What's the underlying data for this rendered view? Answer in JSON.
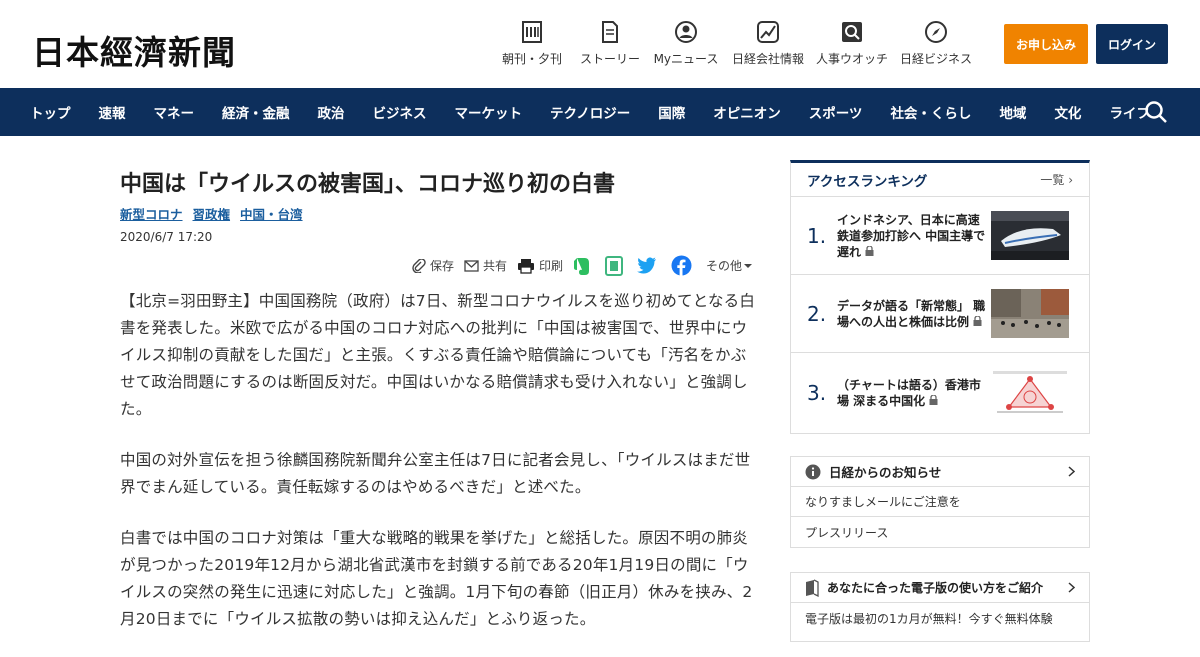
{
  "header": {
    "logo": "日本經濟新聞",
    "nav": [
      {
        "label": "朝刊・夕刊",
        "icon": "newspaper-icon"
      },
      {
        "label": "ストーリー",
        "icon": "story-icon"
      },
      {
        "label": "Myニュース",
        "icon": "user-icon"
      },
      {
        "label": "日経会社情報",
        "icon": "chart-icon"
      },
      {
        "label": "人事ウオッチ",
        "icon": "search-person-icon"
      },
      {
        "label": "日経ビジネス",
        "icon": "compass-icon"
      }
    ],
    "subscribe_label": "お申し込み",
    "login_label": "ログイン"
  },
  "mainnav": {
    "items": [
      "トップ",
      "速報",
      "マネー",
      "経済・金融",
      "政治",
      "ビジネス",
      "マーケット",
      "テクノロジー",
      "国際",
      "オピニオン",
      "スポーツ",
      "社会・くらし",
      "地域",
      "文化",
      "ライフ"
    ]
  },
  "article": {
    "title": "中国は「ウイルスの被害国」、コロナ巡り初の白書",
    "tags": [
      "新型コロナ",
      "習政権",
      "中国・台湾"
    ],
    "date": "2020/6/7 17:20",
    "share": {
      "save": "保存",
      "share": "共有",
      "print": "印刷",
      "more": "その他"
    },
    "paragraphs": [
      "【北京=羽田野主】中国国務院（政府）は7日、新型コロナウイルスを巡り初めてとなる白書を発表した。米欧で広がる中国のコロナ対応への批判に「中国は被害国で、世界中にウイルス抑制の貢献をした国だ」と主張。くすぶる責任論や賠償論についても「汚名をかぶせて政治問題にするのは断固反対だ。中国はいかなる賠償請求も受け入れない」と強調した。",
      "中国の対外宣伝を担う徐麟国務院新聞弁公室主任は7日に記者会見し、「ウイルスはまだ世界でまん延している。責任転嫁するのはやめるべきだ」と述べた。",
      "白書では中国のコロナ対策は「重大な戦略的戦果を挙げた」と総括した。原因不明の肺炎が見つかった2019年12月から湖北省武漢市を封鎖する前である20年1月19日の間に「ウイルスの突然の発生に迅速に対応した」と強調。1月下旬の春節（旧正月）休みを挟み、2月20日までに「ウイルス拡散の勢いは抑え込んだ」とふり返った。"
    ]
  },
  "ranking": {
    "title": "アクセスランキング",
    "more": "一覧",
    "items": [
      {
        "no": "1.",
        "text": "インドネシア、日本に高速鉄道参加打診へ 中国主導で遅れ"
      },
      {
        "no": "2.",
        "text": "データが語る「新常態」 職場への人出と株価は比例"
      },
      {
        "no": "3.",
        "text": "（チャートは語る）香港市場 深まる中国化"
      }
    ]
  },
  "notices": {
    "title": "日経からのお知らせ",
    "rows": [
      "なりすましメールにご注意を",
      "プレスリリース"
    ]
  },
  "guide": {
    "title": "あなたに合った電子版の使い方をご紹介",
    "row": "電子版は最初の1カ月が無料！今すぐ無料体験"
  },
  "colors": {
    "navy": "#0d2f5c",
    "orange": "#f08300",
    "tag_blue": "#1b5e9e"
  }
}
